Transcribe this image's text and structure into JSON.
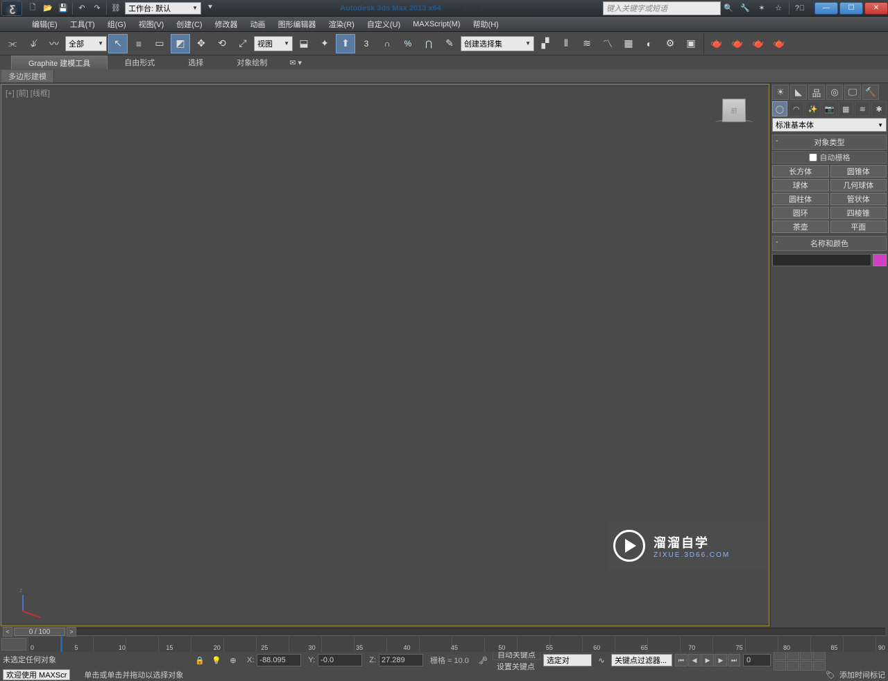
{
  "title": {
    "app": "Autodesk 3ds Max  2013 x64",
    "doc": "无标题",
    "workspace": "工作台: 默认",
    "search_placeholder": "键入关键字或短语"
  },
  "menu": [
    "编辑(E)",
    "工具(T)",
    "组(G)",
    "视图(V)",
    "创建(C)",
    "修改器",
    "动画",
    "图形编辑器",
    "渲染(R)",
    "自定义(U)",
    "MAXScript(M)",
    "帮助(H)"
  ],
  "toolbar": {
    "filter_combo": "全部",
    "refcoord_combo": "视图",
    "selset_combo": "创建选择集"
  },
  "ribbon": {
    "tabs": [
      "Graphite 建模工具",
      "自由形式",
      "选择",
      "对象绘制"
    ],
    "sub": "多边形建模"
  },
  "viewport": {
    "label": "[+] [前] [线框]",
    "cube_face": "前"
  },
  "panel": {
    "primitive_combo": "标准基本体",
    "rollout_obj": "对象类型",
    "autogrid": "自动栅格",
    "buttons": [
      "长方体",
      "圆锥体",
      "球体",
      "几何球体",
      "圆柱体",
      "管状体",
      "圆环",
      "四棱锥",
      "茶壶",
      "平面"
    ],
    "rollout_name": "名称和颜色"
  },
  "timeline": {
    "scrub": "0 / 100",
    "ticks": [
      "0",
      "5",
      "10",
      "15",
      "20",
      "25",
      "30",
      "35",
      "40",
      "45",
      "50",
      "55",
      "60",
      "65",
      "70",
      "75",
      "80",
      "85",
      "90"
    ]
  },
  "status": {
    "line1": "未选定任何对象",
    "line2": "单击或单击并拖动以选择对象",
    "x": "-88.095",
    "y": "-0.0",
    "z": "27.289",
    "grid": "栅格 = 10.0",
    "autokey": "自动关键点",
    "setkey": "设置关键点",
    "sel_lock": "选定对",
    "keyfilter": "关键点过滤器...",
    "addtime": "添加时间标记",
    "frame": "0",
    "welcome": "欢迎使用  MAXScr"
  },
  "watermark": {
    "big": "溜溜自学",
    "small": "ZIXUE.3D66.COM"
  }
}
